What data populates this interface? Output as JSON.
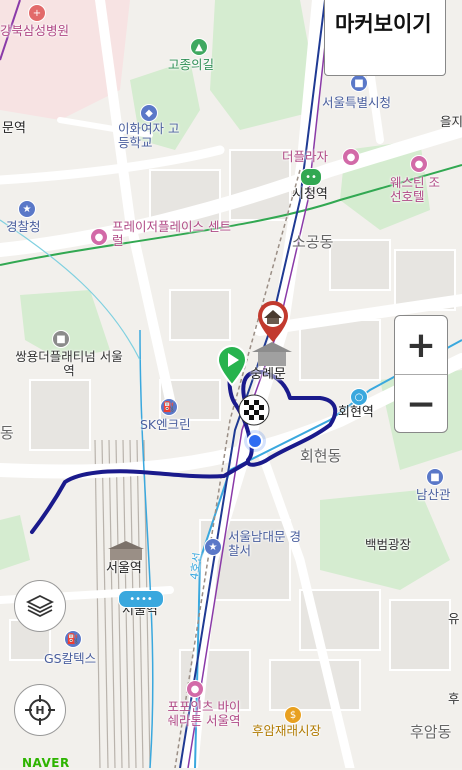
{
  "controls": {
    "marker_toggle_label": "마커보이기",
    "zoom_in": "+",
    "zoom_out": "−",
    "layers_icon": "layers-icon",
    "location_icon": "crosshair-icon"
  },
  "brand": {
    "logo_text": "NAVER"
  },
  "colors": {
    "route": "#1a1a8c",
    "subway_line1": "#1f3a93",
    "subway_line2": "#32a852",
    "subway_line4": "#3aa8de",
    "start_pin": "#27b34e",
    "end_pin": "#c23a2e",
    "current_location": "#2f6df2"
  },
  "labels": {
    "hospital": "강북삼성병원",
    "station_left": "문역",
    "ewha": "이화여자 고등학교",
    "gojong": "고종의길",
    "city_hall": "서울특별시청",
    "eul": "을지",
    "plaza": "더플라자",
    "city_hall_stn": "시청역",
    "westin": "웨스틴 조선호텔",
    "police": "경찰청",
    "praise": "프레이저플레이스 센트럴",
    "sogong": "소공동",
    "ssangyong": "쌍용더플래티넘 서울역",
    "sungnyemun": "숭례문",
    "hoehyeon_stn": "회현역",
    "dong_edge": "동",
    "sk": "SK엔크린",
    "hoehyeon_dong": "회현동",
    "namsan": "남산관",
    "namdaemun_police": "서울남대문 경찰서",
    "baekbeom": "백범광장",
    "seoul_stn_bld": "서울역",
    "seoul_stn": "서울역",
    "gs": "GS칼텍스",
    "line4": "4호선",
    "fourpoints": "포포인츠 바이쉐라톤 서울역",
    "huam_market": "후암재래시장",
    "huam_dong": "후암동",
    "yu": "유",
    "hu": "후"
  }
}
